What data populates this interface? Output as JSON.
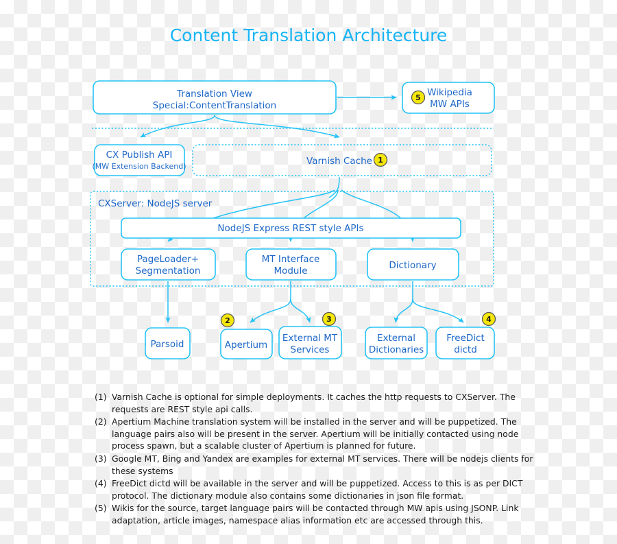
{
  "title": "Content Translation Architecture",
  "colors": {
    "accent": "#25c3f7",
    "title": "#17b4f5",
    "box_text": "#1c67c8",
    "badge_fill": "#f5e70b",
    "badge_stroke": "#595959",
    "note_text": "#1a1a1a"
  },
  "nodes": {
    "translation_view": {
      "line1": "Translation View",
      "line2": "Special:ContentTranslation"
    },
    "wikipedia": {
      "line1": "Wikipedia",
      "line2": "MW APIs",
      "badge": "5"
    },
    "cx_publish_api": {
      "line1": "CX Publish API",
      "line2": "(MW Extension Backend)"
    },
    "varnish_cache": {
      "label": "Varnish Cache",
      "badge": "1"
    },
    "cxserver_group": {
      "label": "CXServer: NodeJS server"
    },
    "rest_apis": {
      "label": "NodeJS Express REST style APIs"
    },
    "pageloader": {
      "line1": "PageLoader+",
      "line2": "Segmentation"
    },
    "mt_interface": {
      "line1": "MT Interface",
      "line2": "Module"
    },
    "dictionary": {
      "label": "Dictionary"
    },
    "parsoid": {
      "label": "Parsoid"
    },
    "apertium": {
      "label": "Apertium",
      "badge": "2"
    },
    "external_mt": {
      "line1": "External MT",
      "line2": "Services",
      "badge": "3"
    },
    "external_dictionaries": {
      "line1": "External",
      "line2": "Dictionaries"
    },
    "freedict": {
      "line1": "FreeDict",
      "line2": "dictd",
      "badge": "4"
    }
  },
  "notes": [
    {
      "num": "(1)",
      "text": "Varnish Cache is optional for simple deployments. It caches the http requests to CXServer. The requests are REST style api calls."
    },
    {
      "num": "(2)",
      "text": "Apertium Machine translation system will be installed in the server and will be puppetized. The language pairs also will be present in the server. Apertium will be initially contacted using node process spawn, but a scalable cluster of Apertium is planned for future."
    },
    {
      "num": "(3)",
      "text": "Google MT, Bing and Yandex are examples for external MT services. There will be nodejs clients for these systems"
    },
    {
      "num": "(4)",
      "text": "FreeDict dictd will be available in the server and will be puppetized. Access to this is as per DICT protocol. The dictionary module also contains some dictionaries in json file format."
    },
    {
      "num": "(5)",
      "text": "Wikis for the source, target language pairs will be contacted through MW apis using JSONP. Link adaptation, article images, namespace alias information etc are accessed through this."
    }
  ]
}
